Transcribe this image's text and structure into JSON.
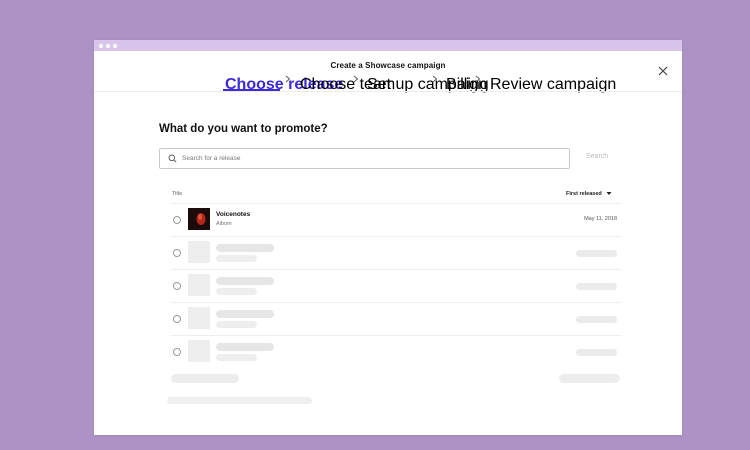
{
  "window": {
    "title": "Create a Showcase campaign"
  },
  "steps": [
    {
      "label": "Choose release",
      "active": true
    },
    {
      "label": "Choose team",
      "active": false
    },
    {
      "label": "Set up campaign",
      "active": false
    },
    {
      "label": "Billing",
      "active": false
    },
    {
      "label": "Review campaign",
      "active": false
    }
  ],
  "main": {
    "heading": "What do you want to promote?",
    "search": {
      "placeholder": "Search for a release",
      "button_label": "Search"
    },
    "table": {
      "col_title": "Title",
      "col_sort": "First released"
    },
    "releases": [
      {
        "title": "Voicenotes",
        "type": "Album",
        "date": "May 11, 2018"
      }
    ]
  },
  "colors": {
    "background": "#ad92c5",
    "titlebar": "#d9c4ec",
    "accent": "#3b2bd8"
  },
  "icons": {
    "close": "close-icon",
    "search": "search-icon",
    "step_separator": "chevron-right-icon",
    "sort": "chevron-down-icon"
  }
}
